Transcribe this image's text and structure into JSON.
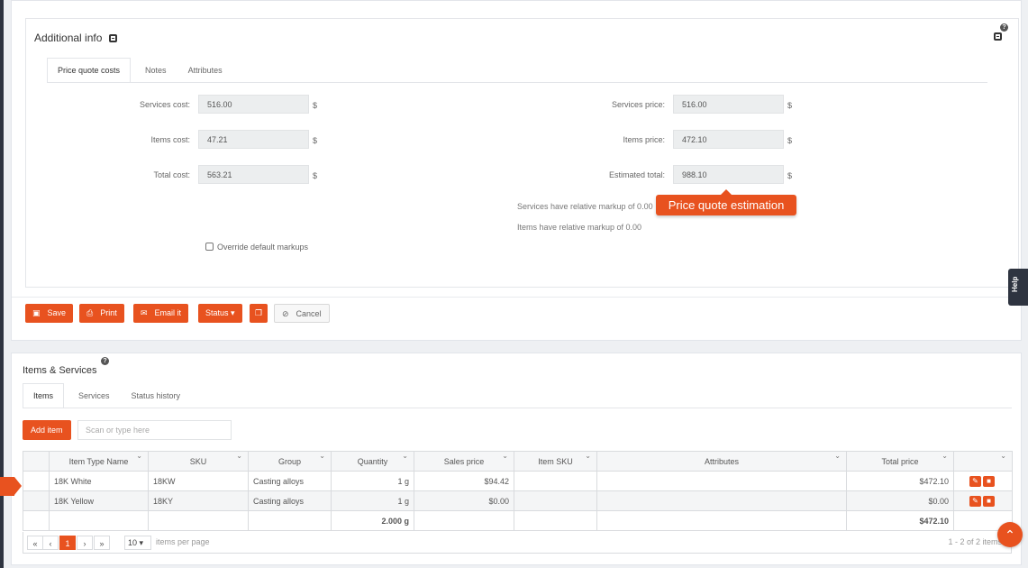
{
  "additional_info": {
    "title": "Additional info",
    "tabs": [
      "Price quote costs",
      "Notes",
      "Attributes"
    ],
    "services_cost_label": "Services cost:",
    "services_cost_value": "516.00",
    "items_cost_label": "Items cost:",
    "items_cost_value": "47.21",
    "total_cost_label": "Total cost:",
    "total_cost_value": "563.21",
    "services_price_label": "Services price:",
    "services_price_value": "516.00",
    "items_price_label": "Items price:",
    "items_price_value": "472.10",
    "estimated_total_label": "Estimated total:",
    "estimated_total_value": "988.10",
    "currency": "$",
    "services_markup_note": "Services have relative markup of 0.00",
    "items_markup_note": "Items have relative markup of 0.00",
    "override_label": "Override default markups",
    "override_checked": false,
    "tooltip": "Price quote estimation",
    "help_mark": "?"
  },
  "toolbar": {
    "save_label": "Save",
    "print_label": "Print",
    "email_label": "Email it",
    "status_label": "Status",
    "cancel_label": "Cancel"
  },
  "help_tab": "Help",
  "items_services": {
    "title": "Items & Services",
    "tabs": [
      "Items",
      "Services",
      "Status history"
    ],
    "add_item_label": "Add item",
    "scan_placeholder": "Scan or type here",
    "columns": [
      "Item Type Name",
      "SKU",
      "Group",
      "Quantity",
      "Sales price",
      "Item SKU",
      "Attributes",
      "Total price",
      ""
    ],
    "rows": [
      {
        "name": "18K White",
        "sku": "18KW",
        "group": "Casting alloys",
        "quantity": "1 g",
        "sales_price": "$94.42",
        "item_sku": "",
        "attributes": "",
        "total_price": "$472.10"
      },
      {
        "name": "18K Yellow",
        "sku": "18KY",
        "group": "Casting alloys",
        "quantity": "1 g",
        "sales_price": "$0.00",
        "item_sku": "",
        "attributes": "",
        "total_price": "$0.00"
      }
    ],
    "totals": {
      "quantity": "2.000 g",
      "total_price": "$472.10"
    },
    "pager": {
      "current_page": "1",
      "per_page": "10",
      "per_page_label": "items per page",
      "info": "1 - 2 of 2 items"
    }
  },
  "colors": {
    "accent": "#e8521f",
    "dark": "#2e3440"
  }
}
